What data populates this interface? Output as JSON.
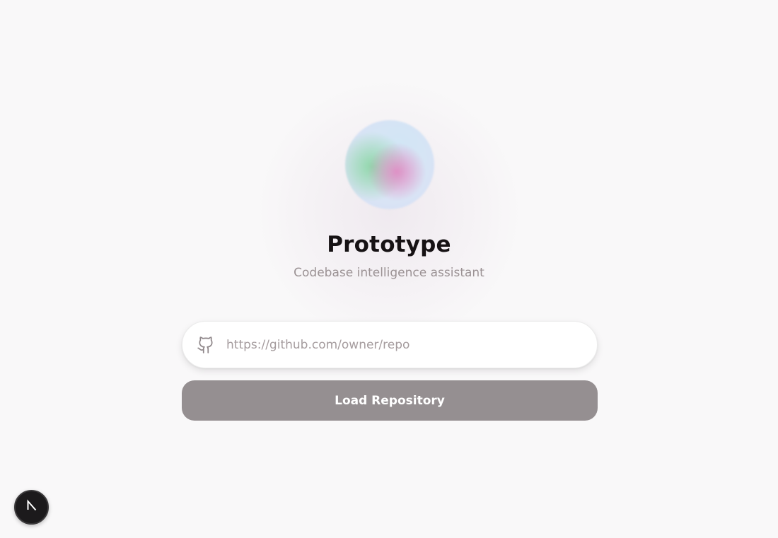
{
  "app": {
    "title": "Prototype",
    "subtitle": "Codebase intelligence assistant"
  },
  "repo_form": {
    "url_placeholder": "https://github.com/owner/repo",
    "url_value": "",
    "url_icon": "github-icon",
    "submit_label": "Load Repository"
  },
  "dev_badge": {
    "icon": "nextjs-icon",
    "letter": "N"
  },
  "colors": {
    "background": "#f9f8f9",
    "title": "#161214",
    "subtitle": "#9b9294",
    "button_bg": "#958f91",
    "button_text": "#ffffff",
    "badge_bg": "#1c1a1c"
  }
}
